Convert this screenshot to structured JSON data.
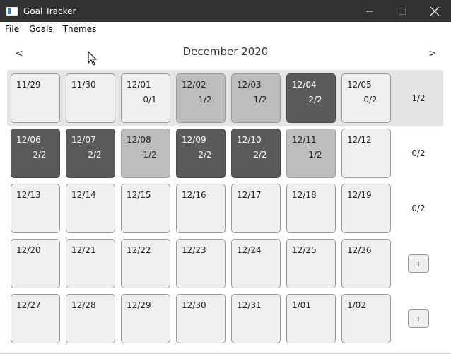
{
  "window": {
    "title": "Goal Tracker",
    "minimize_icon": "minimize-icon",
    "maximize_icon": "maximize-icon",
    "close_icon": "close-icon"
  },
  "menu": {
    "items": [
      "File",
      "Goals",
      "Themes"
    ]
  },
  "calendar": {
    "month_title": "December 2020",
    "prev_label": "<",
    "next_label": ">",
    "weeks": [
      {
        "days": [
          {
            "date": "11/29",
            "score": "",
            "state": "empty"
          },
          {
            "date": "11/30",
            "score": "",
            "state": "empty"
          },
          {
            "date": "12/01",
            "score": "0/1",
            "state": "empty"
          },
          {
            "date": "12/02",
            "score": "1/2",
            "state": "partial"
          },
          {
            "date": "12/03",
            "score": "1/2",
            "state": "partial"
          },
          {
            "date": "12/04",
            "score": "2/2",
            "state": "done"
          },
          {
            "date": "12/05",
            "score": "0/2",
            "state": "empty"
          }
        ],
        "week_score": "1/2",
        "week_action": ""
      },
      {
        "days": [
          {
            "date": "12/06",
            "score": "2/2",
            "state": "done"
          },
          {
            "date": "12/07",
            "score": "2/2",
            "state": "done"
          },
          {
            "date": "12/08",
            "score": "1/2",
            "state": "partial"
          },
          {
            "date": "12/09",
            "score": "2/2",
            "state": "done"
          },
          {
            "date": "12/10",
            "score": "2/2",
            "state": "done"
          },
          {
            "date": "12/11",
            "score": "1/2",
            "state": "partial"
          },
          {
            "date": "12/12",
            "score": "",
            "state": "empty"
          }
        ],
        "week_score": "0/2",
        "week_action": ""
      },
      {
        "days": [
          {
            "date": "12/13",
            "score": "",
            "state": "empty"
          },
          {
            "date": "12/14",
            "score": "",
            "state": "empty"
          },
          {
            "date": "12/15",
            "score": "",
            "state": "empty"
          },
          {
            "date": "12/16",
            "score": "",
            "state": "empty"
          },
          {
            "date": "12/17",
            "score": "",
            "state": "empty"
          },
          {
            "date": "12/18",
            "score": "",
            "state": "empty"
          },
          {
            "date": "12/19",
            "score": "",
            "state": "empty"
          }
        ],
        "week_score": "0/2",
        "week_action": ""
      },
      {
        "days": [
          {
            "date": "12/20",
            "score": "",
            "state": "empty"
          },
          {
            "date": "12/21",
            "score": "",
            "state": "empty"
          },
          {
            "date": "12/22",
            "score": "",
            "state": "empty"
          },
          {
            "date": "12/23",
            "score": "",
            "state": "empty"
          },
          {
            "date": "12/24",
            "score": "",
            "state": "empty"
          },
          {
            "date": "12/25",
            "score": "",
            "state": "empty"
          },
          {
            "date": "12/26",
            "score": "",
            "state": "empty"
          }
        ],
        "week_score": "",
        "week_action": "+"
      },
      {
        "days": [
          {
            "date": "12/27",
            "score": "",
            "state": "empty"
          },
          {
            "date": "12/28",
            "score": "",
            "state": "empty"
          },
          {
            "date": "12/29",
            "score": "",
            "state": "empty"
          },
          {
            "date": "12/30",
            "score": "",
            "state": "empty"
          },
          {
            "date": "12/31",
            "score": "",
            "state": "empty"
          },
          {
            "date": "1/01",
            "score": "",
            "state": "empty"
          },
          {
            "date": "1/02",
            "score": "",
            "state": "empty"
          }
        ],
        "week_score": "",
        "week_action": "+"
      }
    ]
  },
  "colors": {
    "titlebar": "#323232",
    "day_empty": "#efefef",
    "day_partial": "#bdbdbd",
    "day_done": "#5a5a5a",
    "current_week_band": "#e4e4e4"
  }
}
